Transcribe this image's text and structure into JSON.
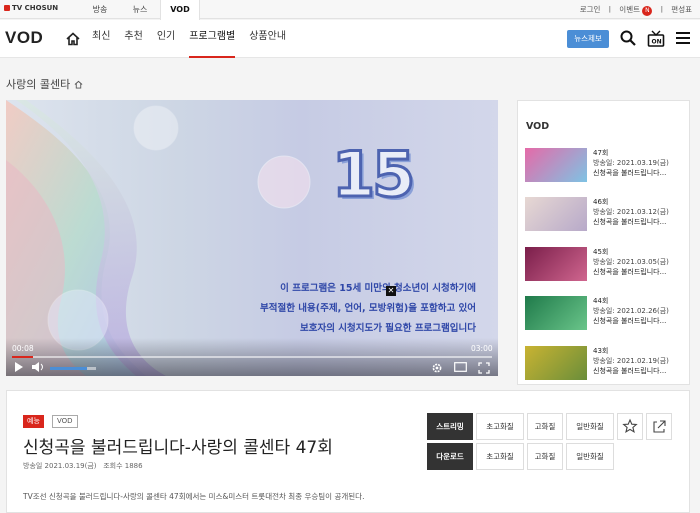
{
  "topbar": {
    "logo": "TV CHOSUN",
    "tabs": [
      "방송",
      "뉴스",
      "VOD"
    ],
    "util": [
      "로그인",
      "이벤트",
      "편성표"
    ],
    "event_badge": "N"
  },
  "nav": {
    "title": "VOD",
    "menu": [
      "최신",
      "추천",
      "인기",
      "프로그램별",
      "상품안내"
    ],
    "active_menu": "프로그램별",
    "news_button": "뉴스제보"
  },
  "breadcrumb": "사랑의 콜센타",
  "player": {
    "rating": "15",
    "warning_lines": [
      "이 프로그램은 15세 미만의 청소년이 시청하기에",
      "부적절한 내용(주제, 언어, 모방위험)을 포함하고 있어",
      "보호자의 시청지도가 필요한 프로그램입니다"
    ],
    "current_time": "00:08",
    "duration": "03:00",
    "progress": 0.044,
    "volume": 0.8
  },
  "sidebar": {
    "title": "VOD",
    "episodes": [
      {
        "ep": "47회",
        "date": "방송일: 2021.03.19(금)",
        "title": "신청곡을 불러드립니다..."
      },
      {
        "ep": "46회",
        "date": "방송일: 2021.03.12(금)",
        "title": "신청곡을 불러드립니다..."
      },
      {
        "ep": "45회",
        "date": "방송일: 2021.03.05(금)",
        "title": "신청곡을 불러드립니다..."
      },
      {
        "ep": "44회",
        "date": "방송일: 2021.02.26(금)",
        "title": "신청곡을 불러드립니다..."
      },
      {
        "ep": "43회",
        "date": "방송일: 2021.02.19(금)",
        "title": "신청곡을 불러드립니다..."
      }
    ]
  },
  "info": {
    "genre_tag": "예능",
    "vod_tag": "VOD",
    "title": "신청곡을 불러드립니다-사랑의 콜센타 47회",
    "air_date": "방송일 2021.03.19(금)",
    "views": "조회수 1886",
    "description": "TV조선 신청곡을 불러드립니다-사랑의 콜센타 47회에서는 미스&미스터 트롯대전차 최종 우승팀이 공개된다.",
    "stream_row": [
      "스트리밍",
      "초고화질",
      "고화질",
      "일반화질"
    ],
    "download_row": [
      "다운로드",
      "초고화질",
      "고화질",
      "일반화질"
    ]
  },
  "colors": {
    "accent_red": "#d9261c",
    "news_blue": "#4b8ed6",
    "warning_blue": "#2f47a8"
  }
}
